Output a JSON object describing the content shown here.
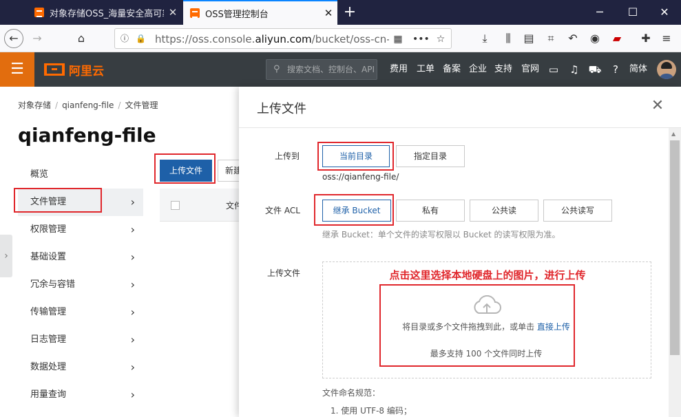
{
  "browser": {
    "tabs": [
      {
        "title": "对象存储OSS_海量安全高可靠"
      },
      {
        "title": "OSS管理控制台"
      }
    ],
    "url_prefix": "https://oss.console.",
    "url_domain": "aliyun.com",
    "url_suffix": "/bucket/oss-cn-beijing"
  },
  "header": {
    "logo_text": "阿里云",
    "search_placeholder": "搜索文档、控制台、API",
    "links": [
      "费用",
      "工单",
      "备案",
      "企业",
      "支持",
      "官网"
    ],
    "lang": "简体",
    "accent_color": "#ff6a00"
  },
  "page": {
    "breadcrumb": [
      "对象存储",
      "qianfeng-file",
      "文件管理"
    ],
    "title": "qianfeng-file",
    "menu": [
      {
        "label": "概览",
        "has_arrow": false
      },
      {
        "label": "文件管理",
        "has_arrow": true
      },
      {
        "label": "权限管理",
        "has_arrow": true
      },
      {
        "label": "基础设置",
        "has_arrow": true
      },
      {
        "label": "冗余与容错",
        "has_arrow": true
      },
      {
        "label": "传输管理",
        "has_arrow": true
      },
      {
        "label": "日志管理",
        "has_arrow": true
      },
      {
        "label": "数据处理",
        "has_arrow": true
      },
      {
        "label": "用量查询",
        "has_arrow": true
      }
    ],
    "upload_label": "上传文件",
    "new_label": "新建",
    "col_file": "文件"
  },
  "modal": {
    "title": "上传文件",
    "upload_to_label": "上传到",
    "current_dir": "当前目录",
    "specified_dir": "指定目录",
    "path": "oss://qianfeng-file/",
    "acl_label": "文件 ACL",
    "acl_options": [
      "继承 Bucket",
      "私有",
      "公共读",
      "公共读写"
    ],
    "acl_hint": "继承 Bucket：单个文件的读写权限以 Bucket 的读写权限为准。",
    "upload_file_label": "上传文件",
    "annotation": "点击这里选择本地硬盘上的图片，进行上传",
    "drop_text": "将目录或多个文件拖拽到此，或单击",
    "drop_link": "直接上传",
    "drop_limit": "最多支持 100 个文件同时上传",
    "naming_title": "文件命名规范：",
    "naming_item_1": "1. 使用 UTF-8 编码；"
  }
}
